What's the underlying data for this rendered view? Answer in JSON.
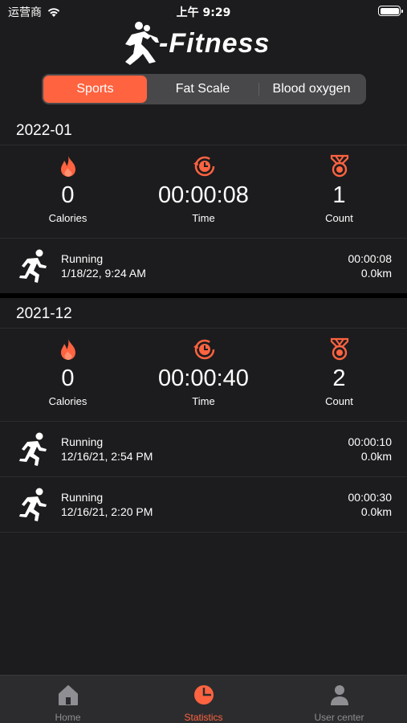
{
  "status_bar": {
    "carrier": "运营商",
    "time": "上午 9:29"
  },
  "brand": {
    "logo_text": "-Fitness",
    "accent": "#ff6340"
  },
  "segments": [
    {
      "label": "Sports",
      "selected": true
    },
    {
      "label": "Fat Scale",
      "selected": false
    },
    {
      "label": "Blood oxygen",
      "selected": false
    }
  ],
  "months": [
    {
      "title": "2022-01",
      "calories": "0",
      "time": "00:00:08",
      "count": "1",
      "records": [
        {
          "name": "Running",
          "date": "1/18/22, 9:24 AM",
          "duration": "00:00:08",
          "distance": "0.0km"
        }
      ]
    },
    {
      "title": "2021-12",
      "calories": "0",
      "time": "00:00:40",
      "count": "2",
      "records": [
        {
          "name": "Running",
          "date": "12/16/21, 2:54 PM",
          "duration": "00:00:10",
          "distance": "0.0km"
        },
        {
          "name": "Running",
          "date": "12/16/21, 2:20 PM",
          "duration": "00:00:30",
          "distance": "0.0km"
        }
      ]
    }
  ],
  "stat_labels": {
    "calories": "Calories",
    "time": "Time",
    "count": "Count"
  },
  "tabs": [
    {
      "label": "Home",
      "icon": "home-icon",
      "active": false
    },
    {
      "label": "Statistics",
      "icon": "pie-chart-icon",
      "active": true
    },
    {
      "label": "User center",
      "icon": "user-icon",
      "active": false
    }
  ]
}
